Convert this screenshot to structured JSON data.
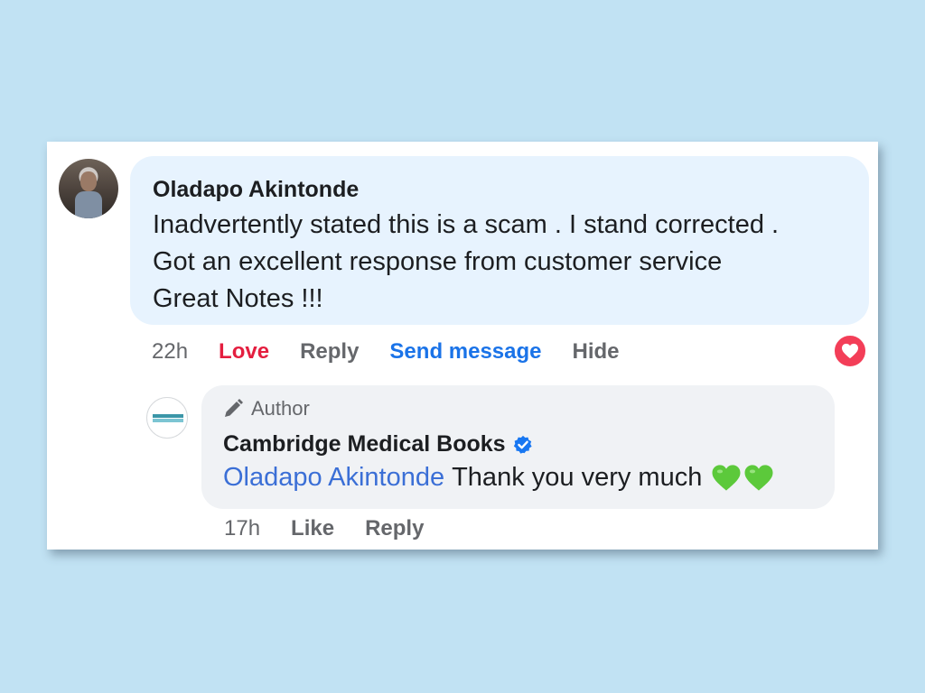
{
  "comment": {
    "author": "Oladapo Akintonde",
    "lines": [
      "Inadvertently stated this is a scam . I stand corrected .",
      "Got an excellent response from customer service",
      "Great Notes !!!"
    ],
    "time": "22h",
    "actions": {
      "love": "Love",
      "reply": "Reply",
      "send_message": "Send message",
      "hide": "Hide"
    },
    "reaction_icon": "love-reaction-icon"
  },
  "reply": {
    "badge": "Author",
    "badge_icon": "pencil-icon",
    "page_name": "Cambridge Medical Books",
    "verified_icon": "verified-badge-icon",
    "mention": "Oladapo Akintonde",
    "text": "Thank you very much",
    "emoji_icons": [
      "green-heart-icon",
      "green-heart-icon"
    ],
    "time": "17h",
    "actions": {
      "like": "Like",
      "reply": "Reply"
    }
  },
  "colors": {
    "background": "#c1e2f3",
    "love": "#e41e3f",
    "link_blue": "#1a73e8",
    "green_heart": "#5cc93b"
  }
}
